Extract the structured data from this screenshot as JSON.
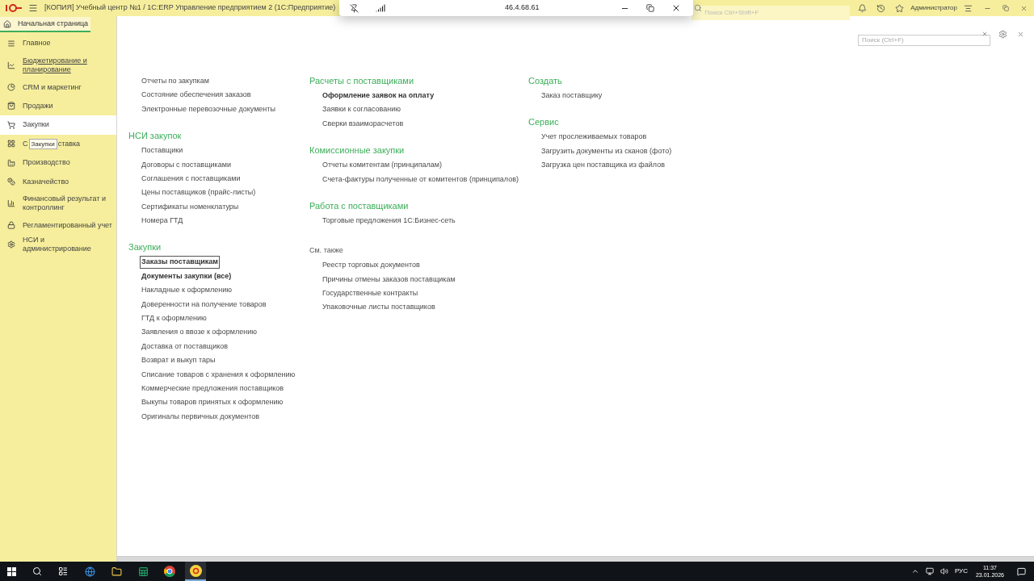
{
  "title_bar": {
    "title": "[КОПИЯ] Учебный центр №1 / 1С:ERP Управление предприятием 2  (1С:Предприятие)",
    "search_placeholder": "Поиск Ctrl+Shift+F",
    "user": "Администратор"
  },
  "remote_bar": {
    "address": "46.4.68.61"
  },
  "home_tab": {
    "label": "Начальная страница"
  },
  "sidebar": {
    "items": [
      {
        "label": "Главное",
        "selected": false,
        "hovered": false
      },
      {
        "label": "Бюджетирование и планирование",
        "selected": false,
        "hovered": true
      },
      {
        "label": "CRM и маркетинг",
        "selected": false,
        "hovered": false
      },
      {
        "label": "Продажи",
        "selected": false,
        "hovered": false
      },
      {
        "label": "Закупки",
        "selected": true,
        "hovered": false
      },
      {
        "label": "С",
        "tooltip": "Закупки",
        "label_tail": "ставка",
        "selected": false,
        "hovered": false
      },
      {
        "label": "Производство",
        "selected": false,
        "hovered": false
      },
      {
        "label": "Казначейство",
        "selected": false,
        "hovered": false
      },
      {
        "label": "Финансовый результат и контроллинг",
        "selected": false,
        "hovered": false
      },
      {
        "label": "Регламентированный учет",
        "selected": false,
        "hovered": false
      },
      {
        "label": "НСИ и администрирование",
        "selected": false,
        "hovered": false
      }
    ]
  },
  "search": {
    "placeholder": "Поиск (Ctrl+F)"
  },
  "columns": [
    {
      "groups": [
        {
          "kind": "section",
          "items": [
            {
              "label": "Отчеты по закупкам",
              "bold": false,
              "focused": false
            },
            {
              "label": "Состояние обеспечения заказов",
              "bold": false,
              "focused": false
            },
            {
              "label": "Электронные перевозочные документы",
              "bold": false,
              "focused": false
            }
          ]
        },
        {
          "kind": "section",
          "heading": "НСИ закупок",
          "items": [
            {
              "label": "Поставщики",
              "bold": false,
              "focused": false
            },
            {
              "label": "Договоры с поставщиками",
              "bold": false,
              "focused": false
            },
            {
              "label": "Соглашения с поставщиками",
              "bold": false,
              "focused": false
            },
            {
              "label": "Цены поставщиков (прайс-листы)",
              "bold": false,
              "focused": false
            },
            {
              "label": "Сертификаты номенклатуры",
              "bold": false,
              "focused": false
            },
            {
              "label": "Номера ГТД",
              "bold": false,
              "focused": false
            }
          ]
        },
        {
          "kind": "section",
          "heading": "Закупки",
          "items": [
            {
              "label": "Заказы поставщикам",
              "bold": true,
              "focused": true
            },
            {
              "label": "Документы закупки (все)",
              "bold": true,
              "focused": false
            },
            {
              "label": "Накладные к оформлению",
              "bold": false,
              "focused": false
            },
            {
              "label": "Доверенности на получение товаров",
              "bold": false,
              "focused": false
            },
            {
              "label": "ГТД к оформлению",
              "bold": false,
              "focused": false
            },
            {
              "label": "Заявления о ввозе к оформлению",
              "bold": false,
              "focused": false
            },
            {
              "label": "Доставка от поставщиков",
              "bold": false,
              "focused": false
            },
            {
              "label": "Возврат и выкуп тары",
              "bold": false,
              "focused": false
            },
            {
              "label": "Списание товаров с хранения к оформлению",
              "bold": false,
              "focused": false
            },
            {
              "label": "Коммерческие предложения поставщиков",
              "bold": false,
              "focused": false
            },
            {
              "label": "Выкупы товаров принятых к оформлению",
              "bold": false,
              "focused": false
            },
            {
              "label": "Оригиналы первичных документов",
              "bold": false,
              "focused": false
            }
          ]
        }
      ]
    },
    {
      "groups": [
        {
          "kind": "section",
          "heading": "Расчеты с поставщиками",
          "items": [
            {
              "label": "Оформление заявок на оплату",
              "bold": true,
              "focused": false
            },
            {
              "label": "Заявки к согласованию",
              "bold": false,
              "focused": false
            },
            {
              "label": "Сверки взаиморасчетов",
              "bold": false,
              "focused": false
            }
          ]
        },
        {
          "kind": "section",
          "heading": "Комиссионные закупки",
          "items": [
            {
              "label": "Отчеты комитентам (принципалам)",
              "bold": false,
              "focused": false
            },
            {
              "label": "Счета-фактуры полученные от комитентов (принципалов)",
              "bold": false,
              "focused": false
            }
          ]
        },
        {
          "kind": "section",
          "heading": "Работа с поставщиками",
          "items": [
            {
              "label": "Торговые предложения 1С:Бизнес-сеть",
              "bold": false,
              "focused": false
            }
          ]
        },
        {
          "kind": "see_also",
          "heading": "См. также",
          "items": [
            {
              "label": "Реестр торговых документов",
              "bold": false,
              "focused": false
            },
            {
              "label": "Причины отмены заказов поставщикам",
              "bold": false,
              "focused": false
            },
            {
              "label": "Государственные контракты",
              "bold": false,
              "focused": false
            },
            {
              "label": "Упаковочные листы поставщиков",
              "bold": false,
              "focused": false
            }
          ]
        }
      ]
    },
    {
      "groups": [
        {
          "kind": "section",
          "heading": "Создать",
          "items": [
            {
              "label": "Заказ поставщику",
              "bold": false,
              "focused": false
            }
          ]
        },
        {
          "kind": "section",
          "heading": "Сервис",
          "items": [
            {
              "label": "Учет прослеживаемых товаров",
              "bold": false,
              "focused": false
            },
            {
              "label": "Загрузить документы из сканов (фото)",
              "bold": false,
              "focused": false
            },
            {
              "label": "Загрузка цен поставщика из файлов",
              "bold": false,
              "focused": false
            }
          ]
        }
      ]
    }
  ],
  "taskbar": {
    "language": "РУС",
    "time": "11:37",
    "date": "23.01.2026"
  }
}
